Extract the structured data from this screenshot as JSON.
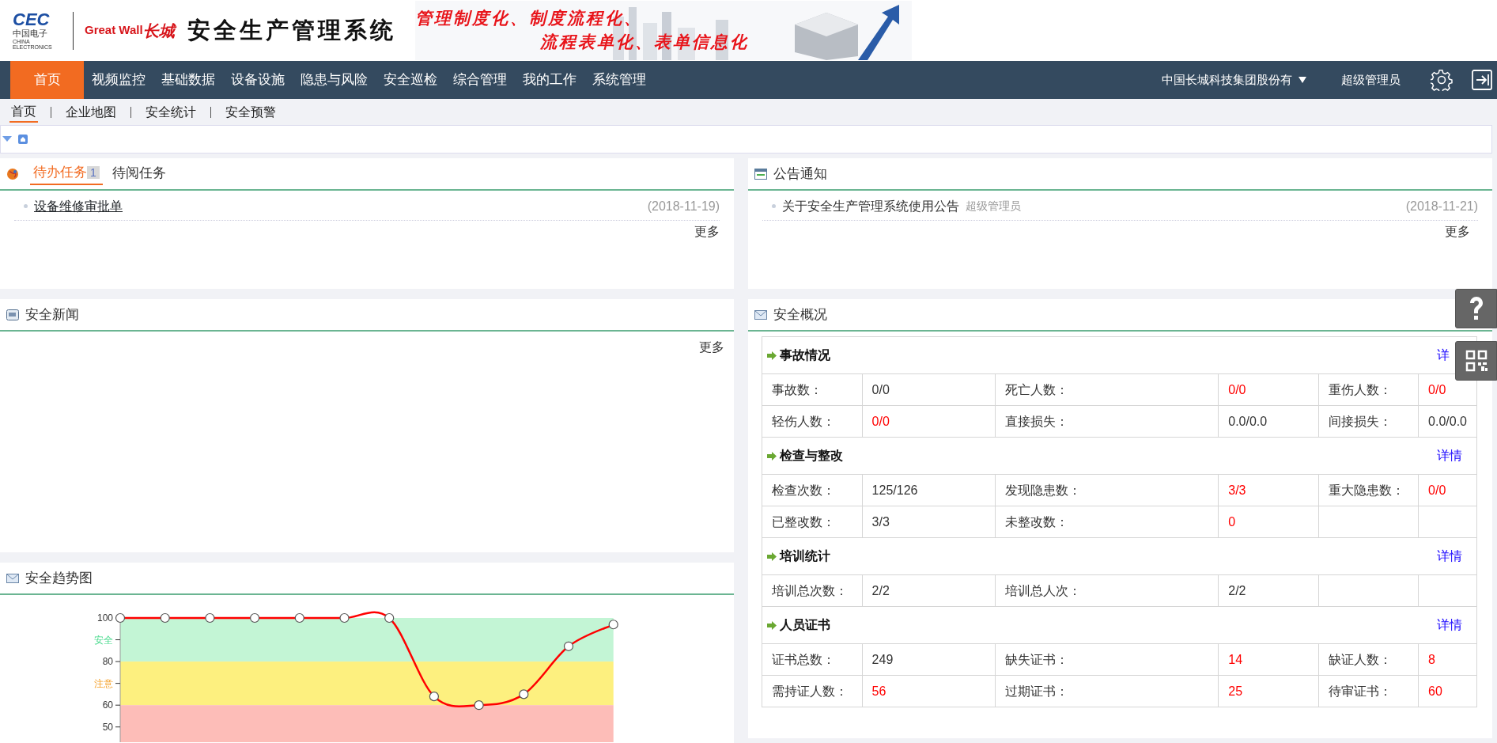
{
  "header": {
    "logo_mark": "CEC",
    "logo_cn": "中国电子",
    "logo_en": "CHINA ELECTRONICS",
    "brand": "Great Wall",
    "brand_cn": "长城",
    "title": "安全生产管理系统",
    "slogan": [
      "管理制度化、制度流程化、",
      "流程表单化、表单信息化"
    ]
  },
  "nav": {
    "items": [
      {
        "label": "首页",
        "selected": true
      },
      {
        "label": "视频监控",
        "selected": false
      },
      {
        "label": "基础数据",
        "selected": false
      },
      {
        "label": "设备设施",
        "selected": false
      },
      {
        "label": "隐患与风险",
        "selected": false
      },
      {
        "label": "安全巡检",
        "selected": false
      },
      {
        "label": "综合管理",
        "selected": false
      },
      {
        "label": "我的工作",
        "selected": false
      },
      {
        "label": "系统管理",
        "selected": false
      }
    ],
    "company": "中国长城科技集团股份有",
    "user": "超级管理员"
  },
  "subnav": [
    {
      "label": "首页",
      "selected": true
    },
    {
      "label": "企业地图",
      "selected": false
    },
    {
      "label": "安全统计",
      "selected": false
    },
    {
      "label": "安全预警",
      "selected": false
    }
  ],
  "todo": {
    "tabs": [
      {
        "label": "待办任务",
        "badge": "1",
        "selected": true
      },
      {
        "label": "待阅任务",
        "selected": false
      }
    ],
    "items": [
      {
        "title": "设备维修审批单",
        "date": "(2018-11-19)"
      }
    ],
    "more": "更多"
  },
  "notices": {
    "title": "公告通知",
    "items": [
      {
        "title": "关于安全生产管理系统使用公告",
        "author": "超级管理员",
        "date": "(2018-11-21)"
      }
    ],
    "more": "更多"
  },
  "news": {
    "title": "安全新闻",
    "more": "更多"
  },
  "trend": {
    "title": "安全趋势图",
    "chart_data": {
      "type": "line",
      "series": [
        {
          "color": "#ff0000",
          "marker": "o",
          "values": [
            100,
            100,
            100,
            100,
            100,
            100,
            100,
            64,
            60,
            65,
            87,
            97
          ]
        }
      ],
      "ylim": [
        43,
        100
      ],
      "yticks": [
        100,
        {
          "value": 90,
          "label": "安全"
        },
        80,
        {
          "value": 70,
          "label": "注意"
        },
        60,
        50
      ],
      "bands": [
        {
          "axis": "y",
          "from": 80,
          "to": 100,
          "color": "#c3f5d5"
        },
        {
          "axis": "y",
          "from": 60,
          "to": 80,
          "color": "#fdf07f"
        },
        {
          "axis": "y",
          "from": 43,
          "to": 60,
          "color": "#fdbdb8"
        }
      ]
    }
  },
  "overview": {
    "title": "安全概况",
    "sections": [
      {
        "title": "事故情况",
        "link": "详",
        "rows": [
          [
            {
              "label": "事故数：",
              "value": "0/0",
              "alert": false
            },
            {
              "label": "死亡人数：",
              "value": "0/0",
              "alert": true
            },
            {
              "label": "重伤人数：",
              "value": "0/0",
              "alert": true
            }
          ],
          [
            {
              "label": "轻伤人数：",
              "value": "0/0",
              "alert": true
            },
            {
              "label": "直接损失：",
              "value": "0.0/0.0",
              "alert": false
            },
            {
              "label": "间接损失：",
              "value": "0.0/0.0",
              "alert": false
            }
          ]
        ]
      },
      {
        "title": "检查与整改",
        "link": "详情",
        "rows": [
          [
            {
              "label": "检查次数：",
              "value": "125/126",
              "alert": false
            },
            {
              "label": "发现隐患数：",
              "value": "3/3",
              "alert": true
            },
            {
              "label": "重大隐患数：",
              "value": "0/0",
              "alert": true
            }
          ],
          [
            {
              "label": "已整改数：",
              "value": "3/3",
              "alert": false
            },
            {
              "label": "未整改数：",
              "value": "0",
              "alert": true
            }
          ]
        ]
      },
      {
        "title": "培训统计",
        "link": "详情",
        "rows": [
          [
            {
              "label": "培训总次数：",
              "value": "2/2",
              "alert": false
            },
            {
              "label": "培训总人次：",
              "value": "2/2",
              "alert": false
            }
          ]
        ]
      },
      {
        "title": "人员证书",
        "link": "详情",
        "rows": [
          [
            {
              "label": "证书总数：",
              "value": "249",
              "alert": false
            },
            {
              "label": "缺失证书：",
              "value": "14",
              "alert": true
            },
            {
              "label": "缺证人数：",
              "value": "8",
              "alert": true
            }
          ],
          [
            {
              "label": "需持证人数：",
              "value": "56",
              "alert": true
            },
            {
              "label": "过期证书：",
              "value": "25",
              "alert": true
            },
            {
              "label": "待审证书：",
              "value": "60",
              "alert": true
            }
          ]
        ]
      }
    ]
  }
}
